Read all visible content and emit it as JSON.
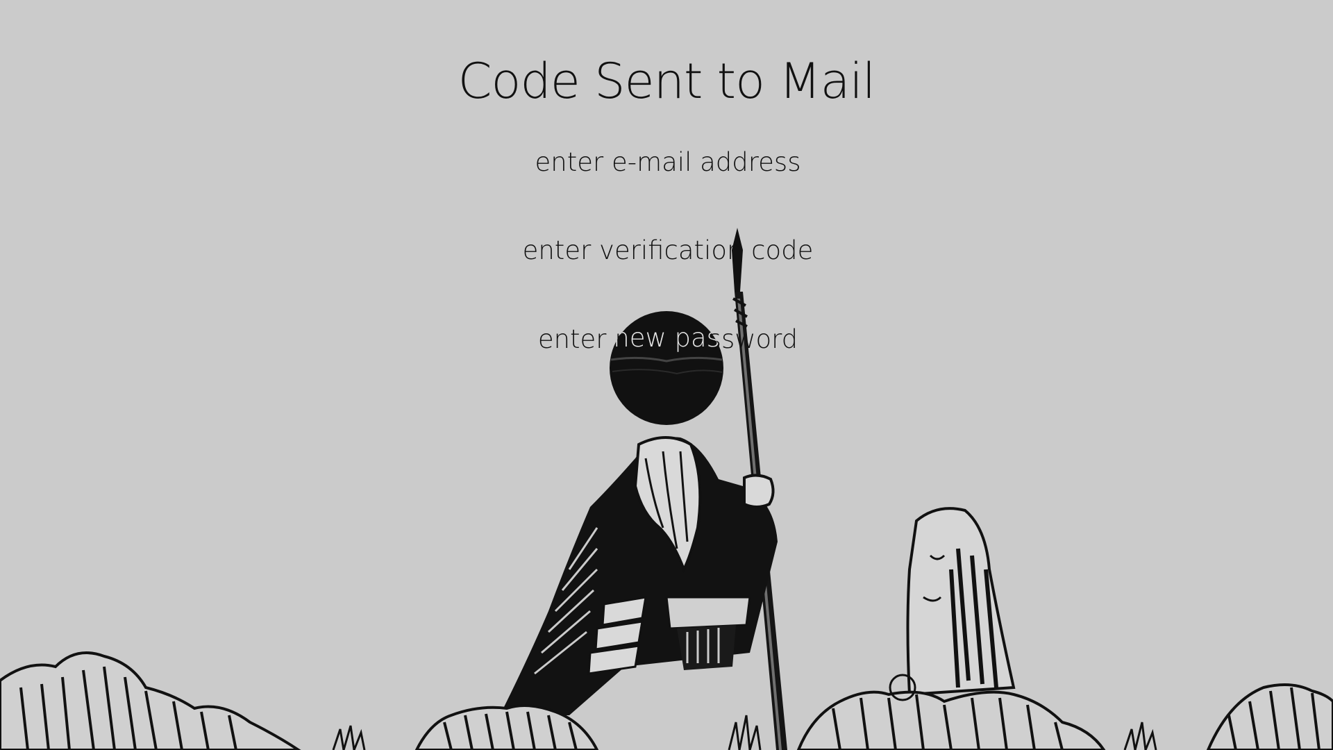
{
  "page": {
    "title": "Code Sent to Mail"
  },
  "form": {
    "email_placeholder": "enter e-mail address",
    "code_placeholder": "enter verification code",
    "password_placeholder": "enter new password"
  },
  "illustration": {
    "subject": "cloaked-warrior-with-spear-under-black-sun",
    "palette": {
      "background": "#cbcbcb",
      "ink": "#0d0d0d"
    }
  }
}
